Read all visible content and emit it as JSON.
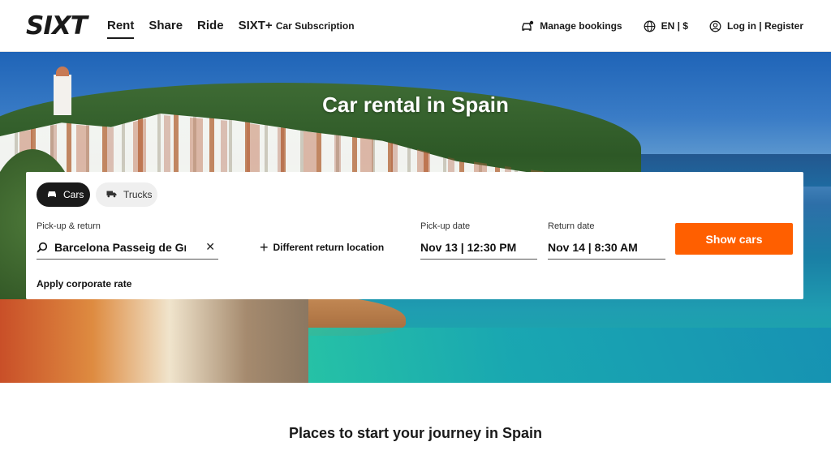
{
  "header": {
    "logo": "SIXT",
    "nav": [
      {
        "label": "Rent",
        "active": true
      },
      {
        "label": "Share",
        "active": false
      },
      {
        "label": "Ride",
        "active": false
      }
    ],
    "subscription": {
      "prefix": "SIXT+",
      "label": "Car Subscription"
    },
    "manage_bookings": "Manage bookings",
    "locale": "EN | $",
    "login": "Log in | Register"
  },
  "hero": {
    "title": "Car rental in Spain"
  },
  "search": {
    "vehicle_tabs": [
      {
        "label": "Cars",
        "icon": "car-icon",
        "active": true
      },
      {
        "label": "Trucks",
        "icon": "truck-icon",
        "active": false
      }
    ],
    "pickup_return_label": "Pick-up & return",
    "location_value": "Barcelona Passeig de Gr",
    "clear_symbol": "✕",
    "different_return": "Different return location",
    "pickup_date_label": "Pick-up date",
    "pickup_date_value": "Nov 13 | 12:30 PM",
    "return_date_label": "Return date",
    "return_date_value": "Nov 14 | 8:30 AM",
    "submit_label": "Show cars",
    "corporate_rate": "Apply corporate rate"
  },
  "colors": {
    "accent": "#ff5f00",
    "text": "#1a1a1a"
  },
  "sections": {
    "places_title": "Places to start your journey in Spain"
  }
}
